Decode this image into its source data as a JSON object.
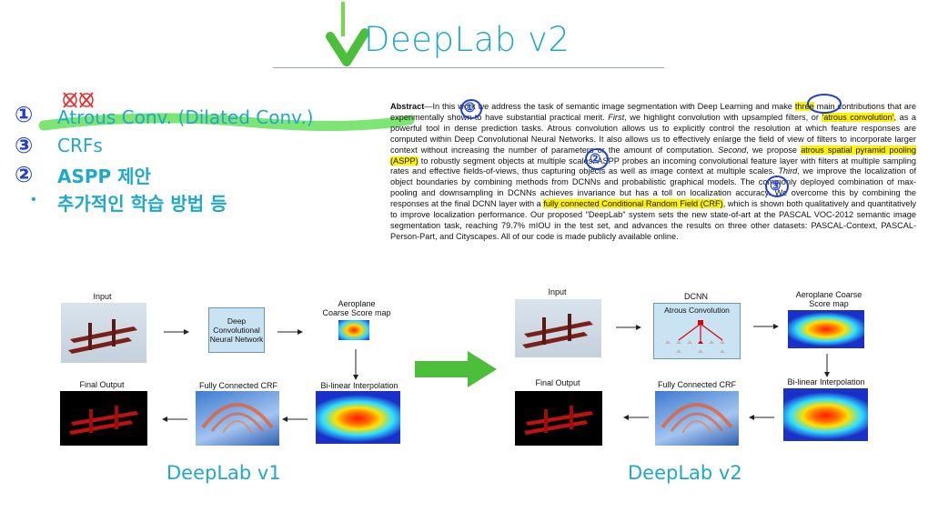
{
  "slide": {
    "title": "DeepLab v2",
    "bullets": [
      {
        "marker": "①",
        "text": "Atrous Conv. (Dilated Conv.)"
      },
      {
        "marker": "③",
        "text": "CRFs"
      },
      {
        "marker": "②",
        "text": "ASPP 제안"
      },
      {
        "marker": "•",
        "text": "추가적인 학습 방법 등"
      }
    ],
    "annotation_marks": [
      "①",
      "②",
      "③"
    ]
  },
  "abstract": {
    "label": "Abstract",
    "t1": "—In this work we address the task of semantic image segmentation with Deep Learning and make ",
    "h_three": "three",
    "t2": " main contributions that are experimentally shown to have substantial practical merit. ",
    "first": "First",
    "t3": ", we highlight convolution with upsampled filters, or ",
    "h_atrous": "'atrous convolution'",
    "t4": ", as a powerful tool in dense prediction tasks. Atrous convolution allows us to explicitly control the resolution at which feature responses are computed within Deep Convolutional Neural Networks. It also allows us to effectively enlarge the field of view of filters to incorporate larger context without increasing the number of parameters or the amount of computation. ",
    "second": "Second",
    "t5": ", we propose ",
    "h_aspp": "atrous spatial pyramid pooling (ASPP)",
    "t6": " to robustly segment objects at multiple scales. ASPP probes an incoming convolutional feature layer with filters at multiple sampling rates and effective fields-of-views, thus capturing objects as well as image context at multiple scales. ",
    "third": "Third",
    "t7": ", we improve the localization of object boundaries by combining methods from DCNNs and probabilistic graphical models. The commonly deployed combination of max-pooling and downsampling in DCNNs achieves invariance but has a toll on localization accuracy. We overcome this by combining the responses at the final DCNN layer with a ",
    "h_crf": "fully connected Conditional Random Field (CRF)",
    "t8": ", which is shown both qualitatively and quantitatively to improve localization performance. Our proposed \"DeepLab\" system sets the new state-of-art at the PASCAL VOC-2012 semantic image segmentation task, reaching 79.7% mIOU in the test set, and advances the results on three other datasets: PASCAL-Context, PASCAL-Person-Part, and Cityscapes. All of our code is made publicly available online."
  },
  "v1": {
    "input": "Input",
    "dcnn": "Deep Convolutional Neural Network",
    "score": "Aeroplane\nCoarse Score map",
    "bilinear": "Bi-linear Interpolation",
    "crf": "Fully Connected CRF",
    "final": "Final Output",
    "footer": "DeepLab v1"
  },
  "v2": {
    "input": "Input",
    "dcnn": "DCNN",
    "atrous": "Atrous Convolution",
    "score": "Aeroplane Coarse\nScore map",
    "bilinear": "Bi-linear Interpolation",
    "crf": "Fully Connected CRF",
    "final": "Final Output",
    "footer": "DeepLab v2"
  },
  "colors": {
    "accent": "#1fa8c9",
    "highlight": "#fff200",
    "green_arrow": "#4cbf3a",
    "annotation_blue": "#1f3fd6",
    "annotation_red": "#e83030",
    "marker_green": "#66e05a"
  },
  "icons": [
    "check-mark-icon",
    "big-right-arrow-icon",
    "flow-arrow-icon"
  ]
}
